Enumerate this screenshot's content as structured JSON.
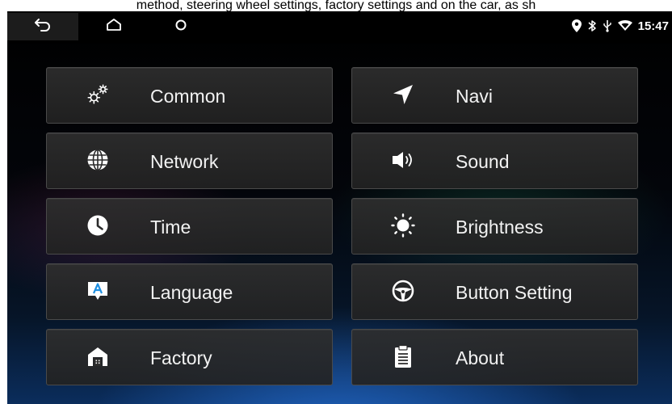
{
  "caption": "method, steering wheel settings, factory settings and on the car, as sh",
  "status": {
    "time": "15:47"
  },
  "navbar": {
    "back_icon": "back-arrow-icon",
    "home_icon": "home-icon",
    "recent_icon": "recent-apps-circle-icon"
  },
  "menu": {
    "left": [
      {
        "label": "Common",
        "icon": "gears-icon"
      },
      {
        "label": "Network",
        "icon": "globe-icon"
      },
      {
        "label": "Time",
        "icon": "clock-icon"
      },
      {
        "label": "Language",
        "icon": "language-icon"
      },
      {
        "label": "Factory",
        "icon": "factory-icon"
      }
    ],
    "right": [
      {
        "label": "Navi",
        "icon": "navigation-arrow-icon"
      },
      {
        "label": "Sound",
        "icon": "speaker-icon"
      },
      {
        "label": "Brightness",
        "icon": "brightness-icon"
      },
      {
        "label": "Button Setting",
        "icon": "steering-wheel-icon"
      },
      {
        "label": "About",
        "icon": "clipboard-icon"
      }
    ]
  },
  "colors": {
    "tile_background": "#2b2b2b",
    "tile_border": "#4a4a4a",
    "label_text": "#f2f2f2",
    "background_glow": "#1f6fd6"
  }
}
